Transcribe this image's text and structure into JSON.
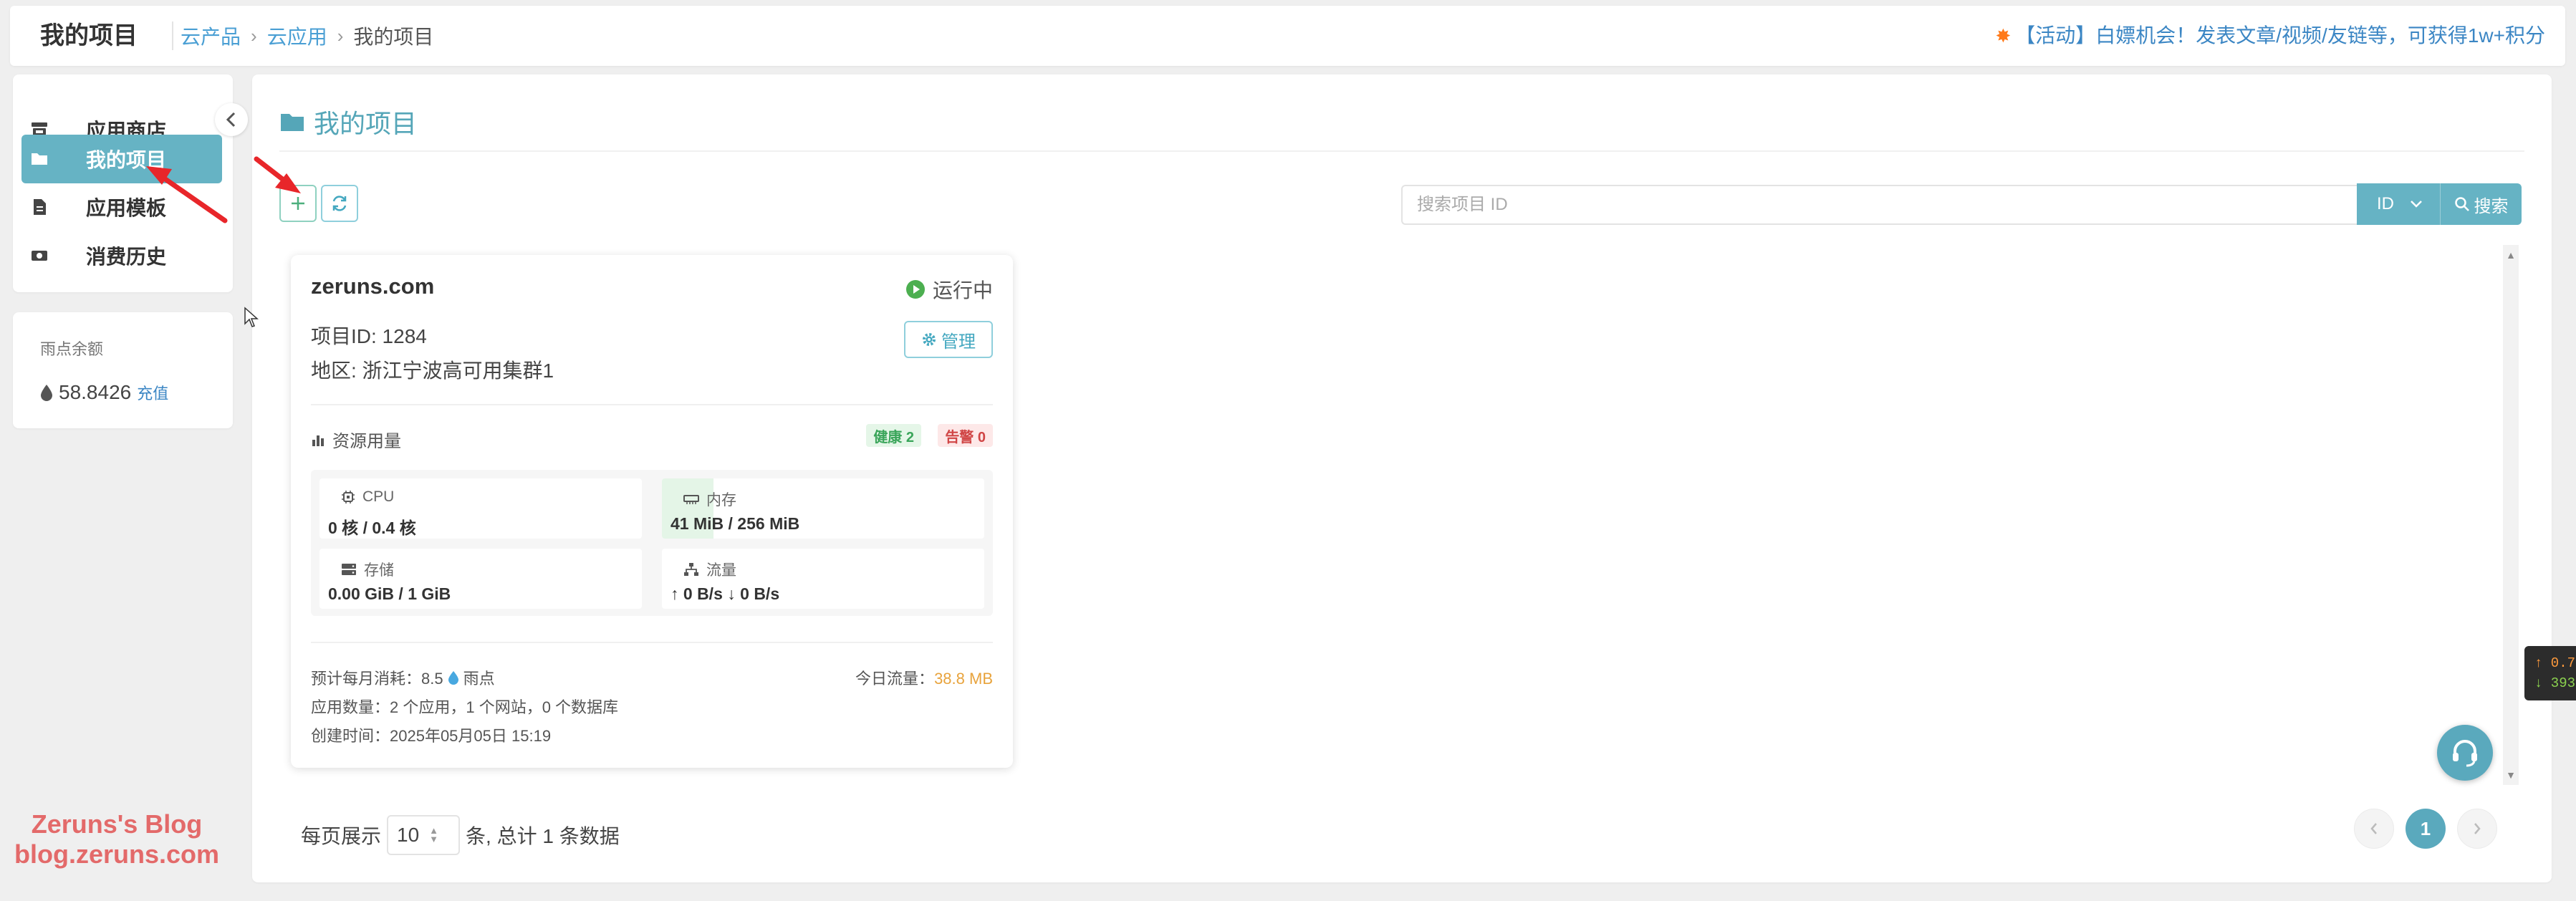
{
  "header": {
    "page_title": "我的项目",
    "breadcrumb": [
      "云产品",
      "云应用",
      "我的项目"
    ],
    "promo_text": "【活动】白嫖机会！发表文章/视频/友链等，可获得1w+积分"
  },
  "sidebar": {
    "items": [
      {
        "label": "应用商店",
        "icon": "store-icon"
      },
      {
        "label": "我的项目",
        "icon": "folder-icon",
        "active": true
      },
      {
        "label": "应用模板",
        "icon": "template-icon"
      },
      {
        "label": "消费历史",
        "icon": "ticket-icon"
      }
    ],
    "balance_label": "雨点余额",
    "balance_value": "58.8426",
    "recharge_label": "充值"
  },
  "main": {
    "section_title": "我的项目",
    "search": {
      "placeholder": "搜索项目 ID",
      "field": "ID",
      "button": "搜索"
    }
  },
  "project": {
    "name": "zeruns.com",
    "status": "运行中",
    "id_text": "项目ID: 1284",
    "region_text": "地区: 浙江宁波高可用集群1",
    "manage_label": "管理",
    "resources_title": "资源用量",
    "healthy_badge": "健康 2",
    "alert_badge": "告警 0",
    "metrics": [
      {
        "label": "CPU",
        "value": "0 核 / 0.4 核",
        "icon": "cpu-icon"
      },
      {
        "label": "内存",
        "value": "41 MiB / 256 MiB",
        "icon": "memory-icon",
        "usage_fraction": 0.16
      },
      {
        "label": "存储",
        "value": "0.00 GiB / 1 GiB",
        "icon": "storage-icon"
      },
      {
        "label": "流量",
        "value": "↑ 0 B/s ↓ 0 B/s",
        "icon": "network-icon"
      }
    ],
    "monthly_cost_prefix": "预计每月消耗：8.5",
    "monthly_cost_unit": "雨点",
    "today_traffic_label": "今日流量：",
    "today_traffic_value": "38.8 MB",
    "app_count": "应用数量：2 个应用，1 个网站，0 个数据库",
    "created_at": "创建时间：2025年05月05日 15:19"
  },
  "pagination": {
    "per_page_prefix": "每页展示",
    "per_page_value": "10",
    "summary": "条, 总计 1 条数据",
    "current_page": "1"
  },
  "net_widget": {
    "up": "↑ 0.7",
    "down": "↓ 393"
  },
  "watermark": {
    "line1": "Zeruns's Blog",
    "line2": "blog.zeruns.com"
  },
  "colors": {
    "accent": "#66b3c4",
    "link": "#4a9fd4",
    "running": "#4caf50",
    "traffic": "#e8a33c"
  }
}
